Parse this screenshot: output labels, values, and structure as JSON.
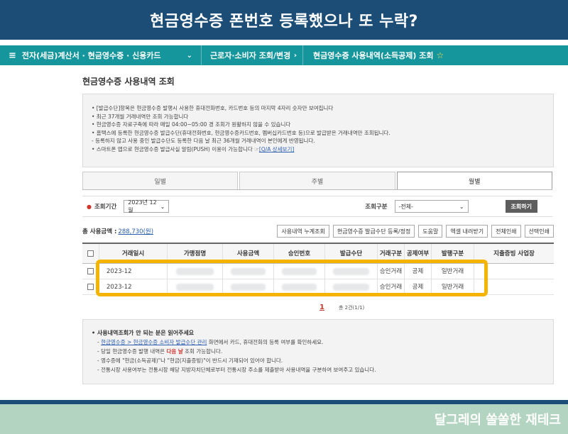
{
  "banner": {
    "title": "현금영수증 폰번호 등록했으나 또 누락?"
  },
  "nav": {
    "menu_label": "전자(세금)계산서 · 현금영수증 · 신용카드",
    "crumb2": "근로자·소비자 조회/변경",
    "crumb3": "현금영수증 사용내역(소득공제) 조회"
  },
  "page_title": "현금영수증 사용내역 조회",
  "info": [
    "• [발급수단]항목은 현금영수증 발행시 사용한 휴대전화번호, 카드번호 등의 마지막 4자리 숫자만 보여집니다",
    "• 최근 37개월 거래내역만 조회 가능합니다",
    "• 현금영수증 자료구축에 따라 매일 04:00~05:00 경 조회가 원활하지 않을 수 있습니다",
    "• 홈택스에 등록한 현금영수증 발급수단(휴대전화번호, 현금영수증카드번호, 멤버십카드번호 등)으로 발급받은 거래내역만 조회됩니다.",
    "  - 등록하지 않고 사용 중인 발급수단도 등록한 다음 날 최근 36개월 거래내역이 본인에게 반영됩니다.",
    "• 스마트폰 앱으로 현금영수증 발급사실 알림(PUSH) 이용이 가능합니다 ☞"
  ],
  "info_link": "[Q/A 상세보기]",
  "tabs": [
    {
      "label": "일별"
    },
    {
      "label": "주별"
    },
    {
      "label": "월별"
    }
  ],
  "search": {
    "period_label": "조회기간",
    "month_value": "2023년 12월",
    "type_label": "조회구분",
    "type_value": "-전체-",
    "search_button": "조회하기"
  },
  "toolbar": {
    "total_label": "총 사용금액 :",
    "total_amount": "288,730(원)",
    "buttons": [
      "사용내역 누계조회",
      "현금영수증 발급수단 등록/정정",
      "도움말",
      "엑셀 내려받기",
      "전체인쇄",
      "선택인쇄"
    ]
  },
  "table": {
    "headers": [
      "거래일시",
      "가맹점명",
      "사용금액",
      "승인번호",
      "발급수단",
      "거래구분",
      "공제여부",
      "발행구분",
      "지출증빙 사업장"
    ],
    "rows": [
      {
        "date": "2023-12",
        "kind": "승인거래",
        "deduct": "공제",
        "issue": "일반거래"
      },
      {
        "date": "2023-12",
        "kind": "승인거래",
        "deduct": "공제",
        "issue": "일반거래"
      }
    ]
  },
  "pager": {
    "page": "1",
    "total": "총 2건(1/1)"
  },
  "notice": {
    "title": "• 사용내역조회가 안 되는 분은 읽어주세요",
    "line1_link": "현금영수증 > 현금영수증 소비자 발급수단 관리",
    "line1_rest": " 화면에서 카드, 휴대전화의 등록 여부를 확인하세요.",
    "line2_pre": "- 당일 현금영수증 발행 내역은 ",
    "line2_red": "다음 날",
    "line2_post": " 조회 가능합니다.",
    "line3": "- 영수증에 \"현금(소득공제)\"나 \"현금(지출증빙)\"이 반드시 기재되어 있어야 합니다.",
    "line4": "- 전통시장 사용여부는 전통시장 해당 지방자치단체로부터 전통시장 주소를 제출받아 사용내역을 구분하여 보여주고 있습니다."
  },
  "watermark": "달그레의 쏠쏠한 재테크",
  "colors": {
    "banner": "#1b4d77",
    "nav": "#15969c",
    "highlight": "#f5b400",
    "footer": "#b3d4c0"
  }
}
